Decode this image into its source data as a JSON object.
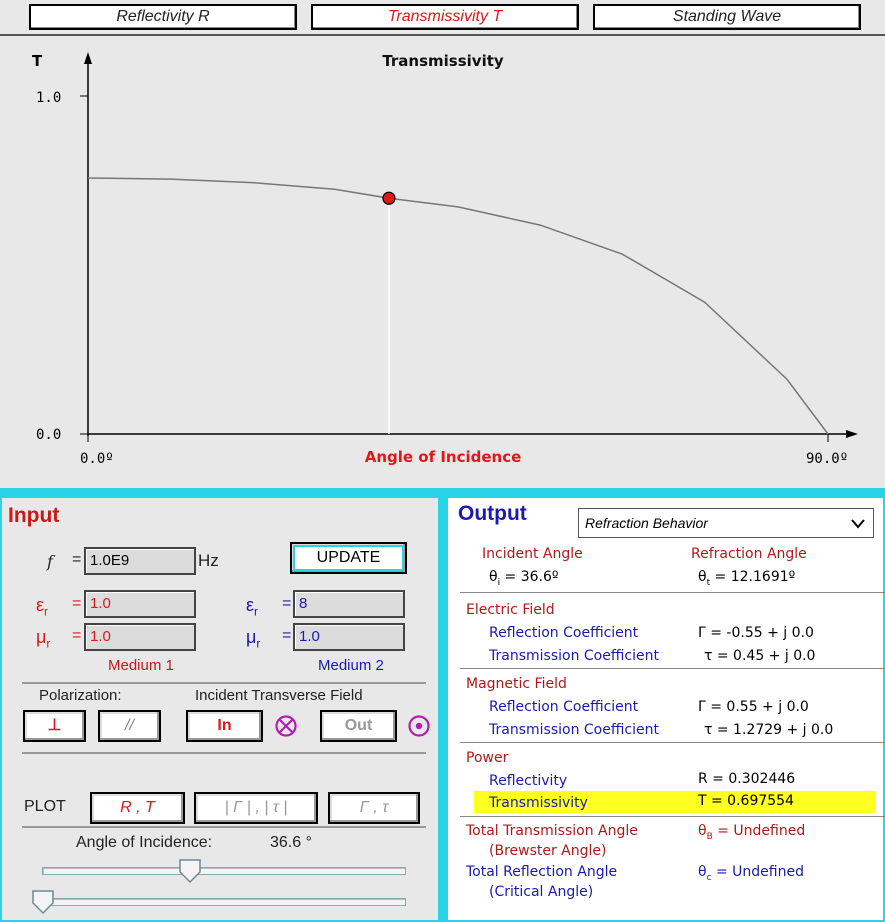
{
  "tabs": [
    {
      "label": "Reflectivity R",
      "active": false
    },
    {
      "label": "Transmissivity T",
      "active": true
    },
    {
      "label": "Standing Wave",
      "active": false
    }
  ],
  "plot": {
    "y_axis_label": "T",
    "title": "Transmissivity",
    "x_label": "Angle of Incidence",
    "y_tick_top": "1.0",
    "y_tick_bottom": "0.0",
    "x_tick_left": "0.0º",
    "x_tick_right": "90.0º",
    "current_angle": 36.6,
    "current_value": 0.697554,
    "colors": {
      "marker": "#e01818",
      "curve": "#777777",
      "xlabel": "#e01818"
    }
  },
  "chart_data": {
    "type": "line",
    "title": "Transmissivity",
    "xlabel": "Angle of Incidence",
    "ylabel": "T",
    "xlim": [
      0,
      90
    ],
    "ylim": [
      0,
      1.0
    ],
    "x": [
      0,
      10,
      20,
      30,
      36.6,
      45,
      55,
      65,
      75,
      85,
      90
    ],
    "series": [
      {
        "values": [
          0.7574,
          0.7542,
          0.7437,
          0.7242,
          0.6976,
          0.672,
          0.618,
          0.532,
          0.39,
          0.162,
          0.0
        ]
      }
    ],
    "marker": {
      "x": 36.6,
      "y": 0.697554
    }
  },
  "input": {
    "title": "Input",
    "freq_symbol": "f",
    "freq_value": "1.0E9",
    "freq_unit": "Hz",
    "update_label": "UPDATE",
    "eps_symbol": "ε",
    "mu_symbol": "μ",
    "sub_r": "r",
    "eq": "=",
    "m1_eps": "1.0",
    "m1_mu": "1.0",
    "m2_eps": "8",
    "m2_mu": "1.0",
    "medium1_label": "Medium 1",
    "medium2_label": "Medium 2",
    "polarization_label": "Polarization:",
    "incident_field_label": "Incident Transverse Field",
    "perp_label": "⊥",
    "par_label": "//",
    "in_label": "In",
    "out_label": "Out",
    "plot_label": "PLOT",
    "plot_rt_label": "R , T",
    "plot_mag_label": "| Γ | , | τ |",
    "plot_coef_label": "Γ , τ",
    "angle_label": "Angle of Incidence:",
    "angle_value": "36.6 °",
    "slider_fraction": 0.407,
    "colors": {
      "red": "#e01818",
      "blue": "#1a1ab0",
      "magenta": "#b020b0"
    }
  },
  "output": {
    "title": "Output",
    "dropdown_value": "Refraction Behavior",
    "incident_angle_label": "Incident Angle",
    "incident_angle_value": "θ i = 36.6º",
    "refraction_angle_label": "Refraction Angle",
    "refraction_angle_value": "θ t = 12.1691º",
    "electric_field_label": "Electric Field",
    "e_refl_label": "Reflection Coefficient",
    "e_refl_value": "Γ  = -0.55 + j 0.0",
    "e_trans_label": "Transmission Coefficient",
    "e_trans_value": "τ = 0.45 + j 0.0",
    "magnetic_field_label": "Magnetic Field",
    "m_refl_label": "Reflection Coefficient",
    "m_refl_value": "Γ  = 0.55 + j 0.0",
    "m_trans_label": "Transmission Coefficient",
    "m_trans_value": "τ = 1.2729 + j 0.0",
    "power_label": "Power",
    "reflectivity_label": "Reflectivity",
    "reflectivity_value": "R  = 0.302446",
    "transmissivity_label": "Transmissivity",
    "transmissivity_value": "T  = 0.697554",
    "ttotal_label": "Total Transmission Angle",
    "brewster_label": "(Brewster Angle)",
    "brewster_value": "θ B = Undefined",
    "rtotal_label": "Total Reflection Angle",
    "critical_label": "(Critical Angle)",
    "critical_value": "θ c = Undefined",
    "colors": {
      "highlight": "#ffff22",
      "label_red": "#b01818",
      "label_blue": "#1a1ab0"
    }
  }
}
